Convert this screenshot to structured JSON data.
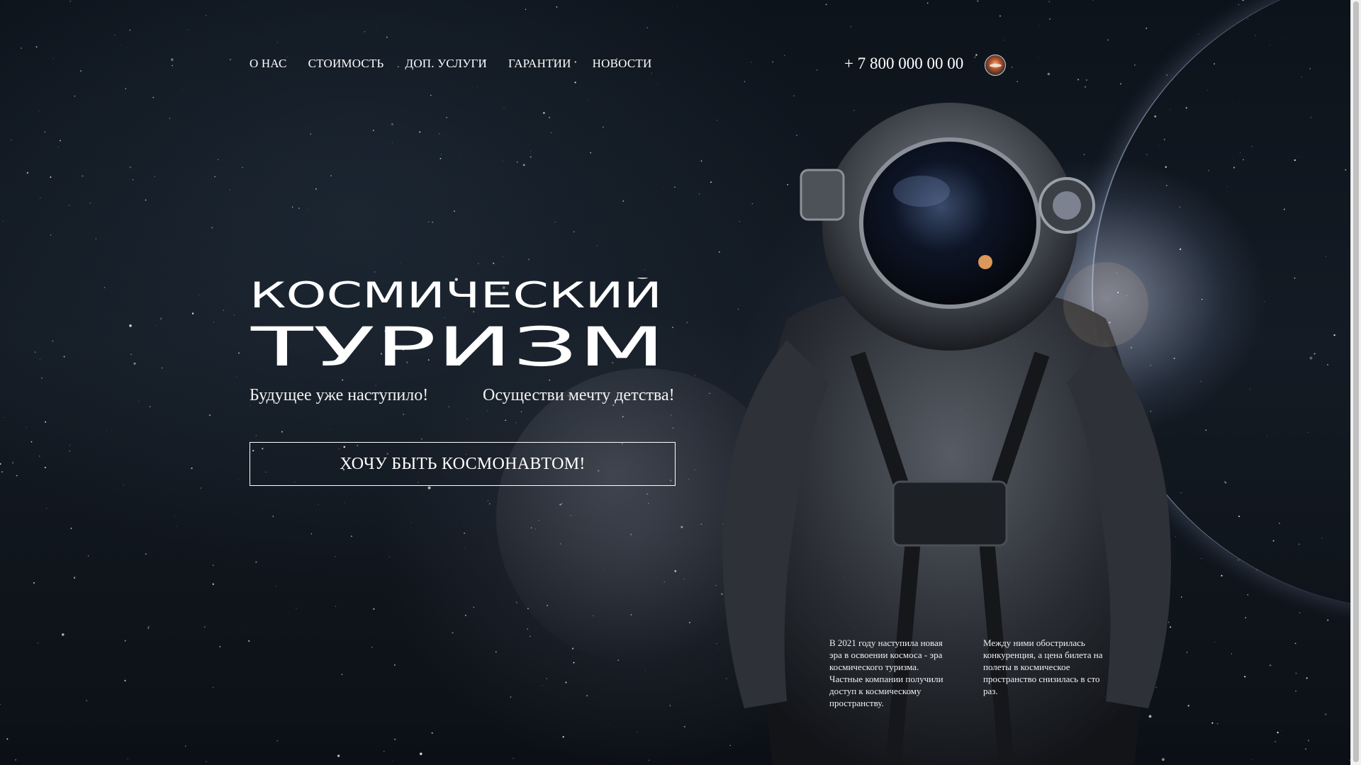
{
  "nav": {
    "items": [
      {
        "label": "О НАС"
      },
      {
        "label": "СТОИМОСТЬ"
      },
      {
        "label": "ДОП. УСЛУГИ"
      },
      {
        "label": "ГАРАНТИИ"
      },
      {
        "label": "НОВОСТИ"
      }
    ]
  },
  "header": {
    "phone": "+ 7 800 000 00 00",
    "avatar_icon": "profile-avatar-icon"
  },
  "hero": {
    "title_line1": "КОСМИЧЕСКИЙ",
    "title_line2": "ТУРИЗМ",
    "subtitle_left": "Будущее уже наступило!",
    "subtitle_right": "Осуществи мечту детства!",
    "cta_label": "ХОЧУ БЫТЬ КОСМОНАВТОМ!"
  },
  "info": {
    "left": "В 2021 году наступила новая эра в освоении космоса - эра космического туризма. Частные компании получили доступ к космическому пространству.",
    "right": "Между ними обострилась конкуренция, а цена билета на полеты в космическое пространство снизилась в сто раз."
  },
  "colors": {
    "background": "#0d131b",
    "text": "#ffffff",
    "accent_glow": "#c8d2eb"
  }
}
